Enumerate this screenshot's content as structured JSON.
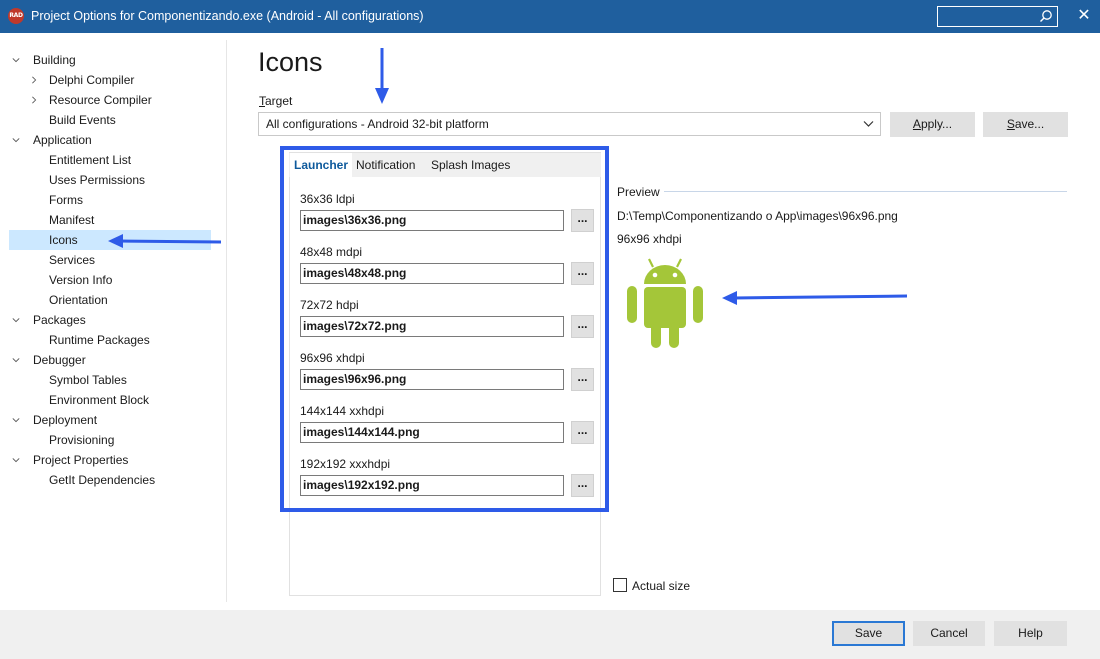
{
  "window": {
    "app_badge": "RAD",
    "title": "Project Options for Componentizando.exe  (Android - All configurations)",
    "search_value": "",
    "close_glyph": "✕"
  },
  "tree": [
    {
      "label": "Building",
      "expanded": true
    },
    {
      "label": "Delphi Compiler",
      "collapsed": true
    },
    {
      "label": "Resource Compiler",
      "collapsed": true
    },
    {
      "label": "Build Events"
    },
    {
      "label": "Application",
      "expanded": true
    },
    {
      "label": "Entitlement List"
    },
    {
      "label": "Uses Permissions"
    },
    {
      "label": "Forms"
    },
    {
      "label": "Manifest"
    },
    {
      "label": "Icons",
      "selected": true
    },
    {
      "label": "Services"
    },
    {
      "label": "Version Info"
    },
    {
      "label": "Orientation"
    },
    {
      "label": "Packages",
      "expanded": true
    },
    {
      "label": "Runtime Packages"
    },
    {
      "label": "Debugger",
      "expanded": true
    },
    {
      "label": "Symbol Tables"
    },
    {
      "label": "Environment Block"
    },
    {
      "label": "Deployment",
      "expanded": true
    },
    {
      "label": "Provisioning"
    },
    {
      "label": "Project Properties",
      "expanded": true
    },
    {
      "label": "GetIt Dependencies"
    }
  ],
  "page": {
    "title": "Icons",
    "target_label_underlined": "T",
    "target_label_rest": "arget",
    "target_value": "All configurations - Android 32-bit platform",
    "apply_label_underlined": "A",
    "apply_label_rest": "pply...",
    "save_label_underlined": "S",
    "save_label_rest": "ave..."
  },
  "tabs": [
    {
      "label": "Launcher",
      "active": true
    },
    {
      "label": "Notification"
    },
    {
      "label": "Splash Images"
    }
  ],
  "icons": [
    {
      "label": "36x36 ldpi",
      "value": "images\\36x36.png",
      "browse": "..."
    },
    {
      "label": "48x48 mdpi",
      "value": "images\\48x48.png",
      "browse": "..."
    },
    {
      "label": "72x72 hdpi",
      "value": "images\\72x72.png",
      "browse": "..."
    },
    {
      "label": "96x96 xhdpi",
      "value": "images\\96x96.png",
      "browse": "..."
    },
    {
      "label": "144x144 xxhdpi",
      "value": "images\\144x144.png",
      "browse": "..."
    },
    {
      "label": "192x192 xxxhdpi",
      "value": "images\\192x192.png",
      "browse": "..."
    }
  ],
  "preview": {
    "label": "Preview",
    "path": "D:\\Temp\\Componentizando o App\\images\\96x96.png",
    "size": "96x96 xhdpi",
    "actual_size_label": "Actual size",
    "actual_size_checked": false
  },
  "footer": {
    "save": "Save",
    "cancel": "Cancel",
    "help": "Help"
  },
  "colors": {
    "titlebar": "#1f5f9e",
    "accent_tab": "#0e5a9c",
    "annotation_blue": "#2e5be8",
    "android_green": "#a4c639",
    "selection": "#cce8ff"
  },
  "icon_names": [
    "search-icon",
    "close-icon",
    "chevron-down-icon",
    "chevron-right-icon",
    "android-robot-icon",
    "arrow-annotation"
  ]
}
